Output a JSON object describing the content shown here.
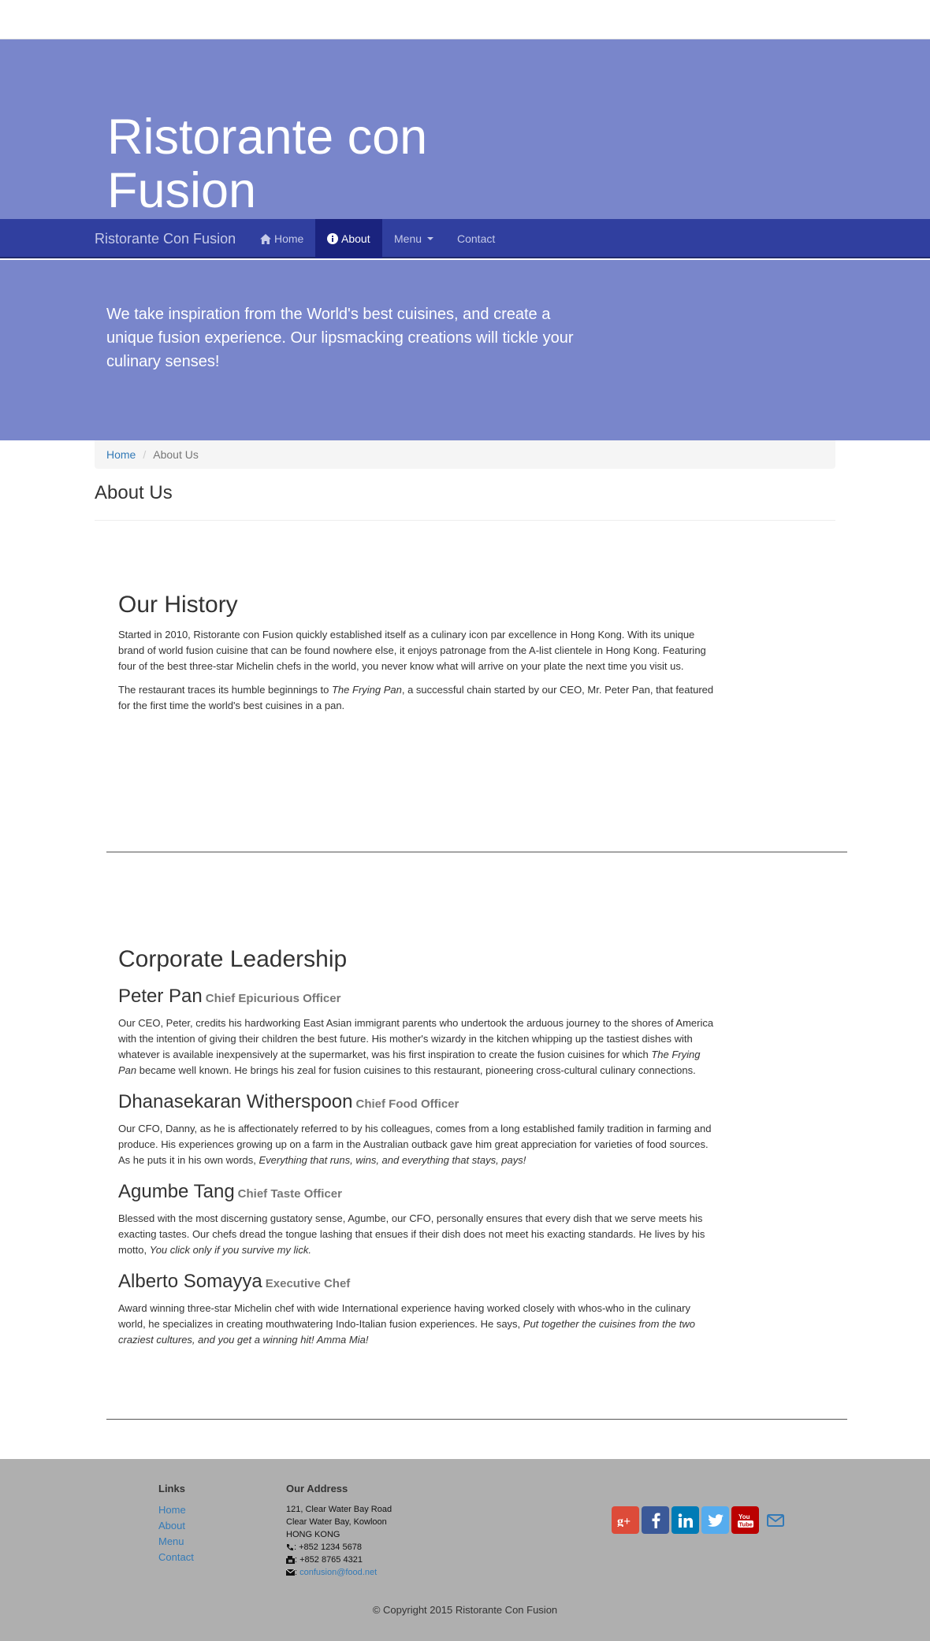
{
  "hero": {
    "title": "Ristorante con Fusion",
    "tagline": "We take inspiration from the World's best cuisines, and create a unique fusion experience. Our lipsmacking creations will tickle your culinary senses!"
  },
  "navbar": {
    "brand": "Ristorante Con Fusion",
    "items": [
      {
        "label": "Home",
        "icon": "home-icon"
      },
      {
        "label": "About",
        "icon": "info-icon",
        "active": true
      },
      {
        "label": "Menu",
        "icon": "caret-down-icon"
      },
      {
        "label": "Contact"
      }
    ]
  },
  "breadcrumb": {
    "home": "Home",
    "current": "About Us"
  },
  "page_title": "About Us",
  "history": {
    "heading": "Our History",
    "p1": "Started in 2010, Ristorante con Fusion quickly established itself as a culinary icon par excellence in Hong Kong. With its unique brand of world fusion cuisine that can be found nowhere else, it enjoys patronage from the A-list clientele in Hong Kong. Featuring four of the best three-star Michelin chefs in the world, you never know what will arrive on your plate the next time you visit us.",
    "p2_before": "The restaurant traces its humble beginnings to ",
    "p2_em": "The Frying Pan",
    "p2_after": ", a successful chain started by our CEO, Mr. Peter Pan, that featured for the first time the world's best cuisines in a pan."
  },
  "leadership": {
    "heading": "Corporate Leadership",
    "people": [
      {
        "name": "Peter Pan",
        "role": "Chief Epicurious Officer",
        "text_before": "Our CEO, Peter, credits his hardworking East Asian immigrant parents who undertook the arduous journey to the shores of America with the intention of giving their children the best future. His mother's wizardy in the kitchen whipping up the tastiest dishes with whatever is available inexpensively at the supermarket, was his first inspiration to create the fusion cuisines for which ",
        "text_em": "The Frying Pan",
        "text_after": " became well known. He brings his zeal for fusion cuisines to this restaurant, pioneering cross-cultural culinary connections."
      },
      {
        "name": "Dhanasekaran Witherspoon",
        "role": "Chief Food Officer",
        "text_before": "Our CFO, Danny, as he is affectionately referred to by his colleagues, comes from a long established family tradition in farming and produce. His experiences growing up on a farm in the Australian outback gave him great appreciation for varieties of food sources. As he puts it in his own words, ",
        "text_em": "Everything that runs, wins, and everything that stays, pays!",
        "text_after": ""
      },
      {
        "name": "Agumbe Tang",
        "role": "Chief Taste Officer",
        "text_before": "Blessed with the most discerning gustatory sense, Agumbe, our CFO, personally ensures that every dish that we serve meets his exacting tastes. Our chefs dread the tongue lashing that ensues if their dish does not meet his exacting standards. He lives by his motto, ",
        "text_em": "You click only if you survive my lick.",
        "text_after": ""
      },
      {
        "name": "Alberto Somayya",
        "role": "Executive Chef",
        "text_before": "Award winning three-star Michelin chef with wide International experience having worked closely with whos-who in the culinary world, he specializes in creating mouthwatering Indo-Italian fusion experiences. He says, ",
        "text_em": "Put together the cuisines from the two craziest cultures, and you get a winning hit! Amma Mia!",
        "text_after": ""
      }
    ]
  },
  "footer": {
    "links_heading": "Links",
    "links": [
      "Home",
      "About",
      "Menu",
      "Contact"
    ],
    "address_heading": "Our Address",
    "address_lines": [
      "121, Clear Water Bay Road",
      "Clear Water Bay, Kowloon",
      "HONG KONG"
    ],
    "phone": ": +852 1234 5678",
    "fax": ": +852 8765 4321",
    "email_prefix": ": ",
    "email": "confusion@food.net",
    "social": [
      "google-plus-icon",
      "facebook-icon",
      "linkedin-icon",
      "twitter-icon",
      "youtube-icon",
      "envelope-icon"
    ],
    "copyright": "© Copyright 2015 Ristorante Con Fusion"
  },
  "colors": {
    "hero_bg": "#7986cb",
    "navbar_bg": "#303f9f",
    "navbar_active": "#1a237e",
    "footer_bg": "#afafaf",
    "link": "#337ab7"
  }
}
